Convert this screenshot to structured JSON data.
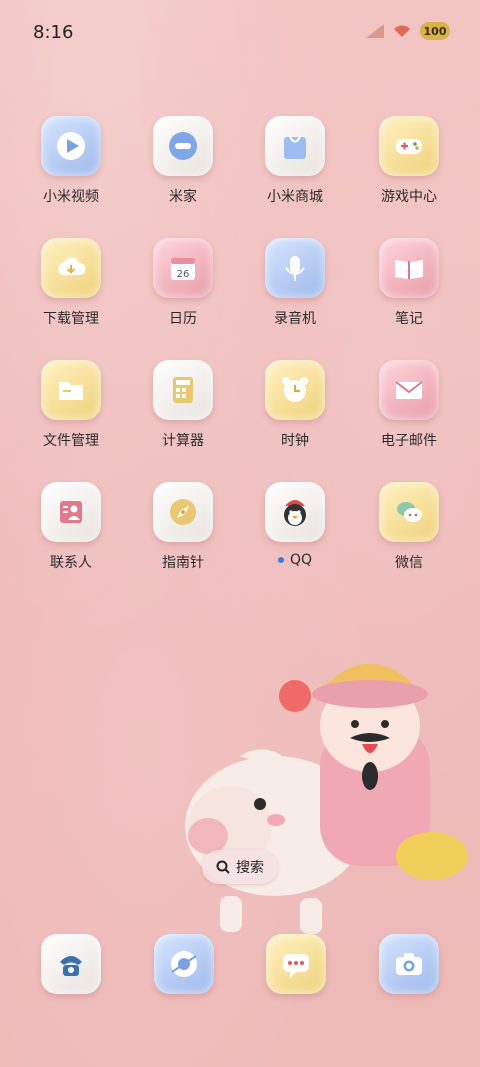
{
  "status": {
    "time": "8:16",
    "battery": "100"
  },
  "apps": [
    {
      "label": "小米视频",
      "icon": "video-play-icon"
    },
    {
      "label": "米家",
      "icon": "mijia-icon"
    },
    {
      "label": "小米商城",
      "icon": "shopping-bag-icon"
    },
    {
      "label": "游戏中心",
      "icon": "gamepad-icon"
    },
    {
      "label": "下载管理",
      "icon": "cloud-download-icon"
    },
    {
      "label": "日历",
      "icon": "calendar-icon",
      "day": "26"
    },
    {
      "label": "录音机",
      "icon": "microphone-icon"
    },
    {
      "label": "笔记",
      "icon": "notebook-icon"
    },
    {
      "label": "文件管理",
      "icon": "folder-icon"
    },
    {
      "label": "计算器",
      "icon": "calculator-icon"
    },
    {
      "label": "时钟",
      "icon": "alarm-clock-icon"
    },
    {
      "label": "电子邮件",
      "icon": "envelope-icon"
    },
    {
      "label": "联系人",
      "icon": "contact-card-icon"
    },
    {
      "label": "指南针",
      "icon": "compass-icon"
    },
    {
      "label": "QQ",
      "icon": "penguin-icon"
    },
    {
      "label": "微信",
      "icon": "wechat-icon"
    }
  ],
  "search": {
    "label": "搜索"
  },
  "dock": [
    {
      "icon": "phone-icon"
    },
    {
      "icon": "browser-icon"
    },
    {
      "icon": "messages-icon"
    },
    {
      "icon": "camera-icon"
    }
  ]
}
